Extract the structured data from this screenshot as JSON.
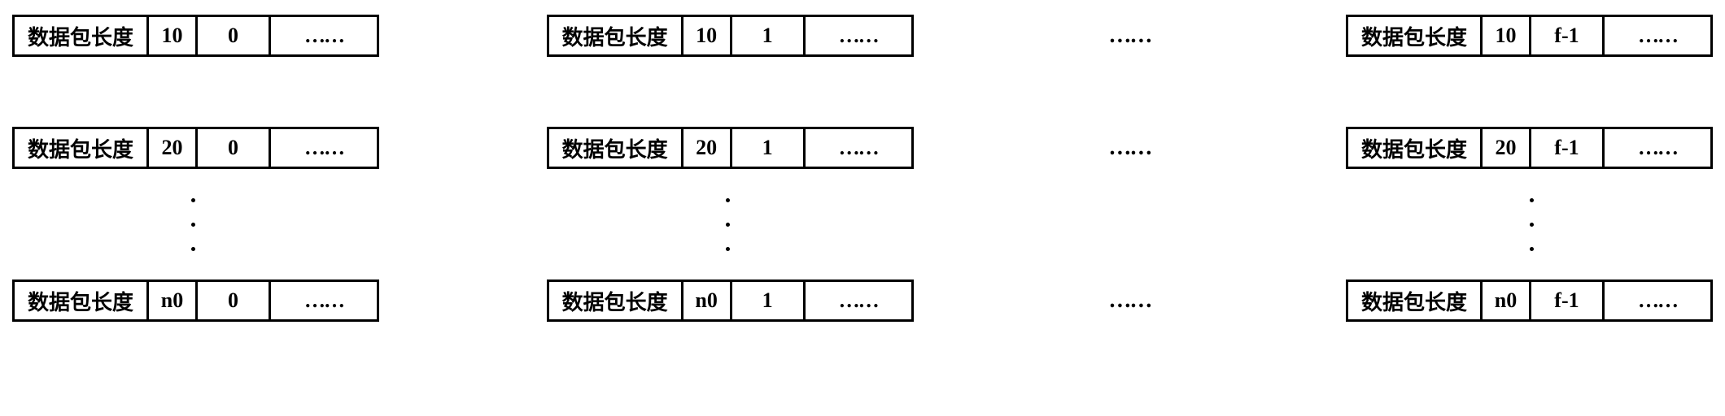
{
  "label": "数据包长度",
  "ellipsis": "……",
  "gap_ellipsis": "……",
  "columns": [
    {
      "seq": "0"
    },
    {
      "seq": "1"
    },
    {
      "seq": "f-1"
    }
  ],
  "rows": [
    {
      "id": "10"
    },
    {
      "id": "20"
    },
    {
      "id": "n0"
    }
  ]
}
